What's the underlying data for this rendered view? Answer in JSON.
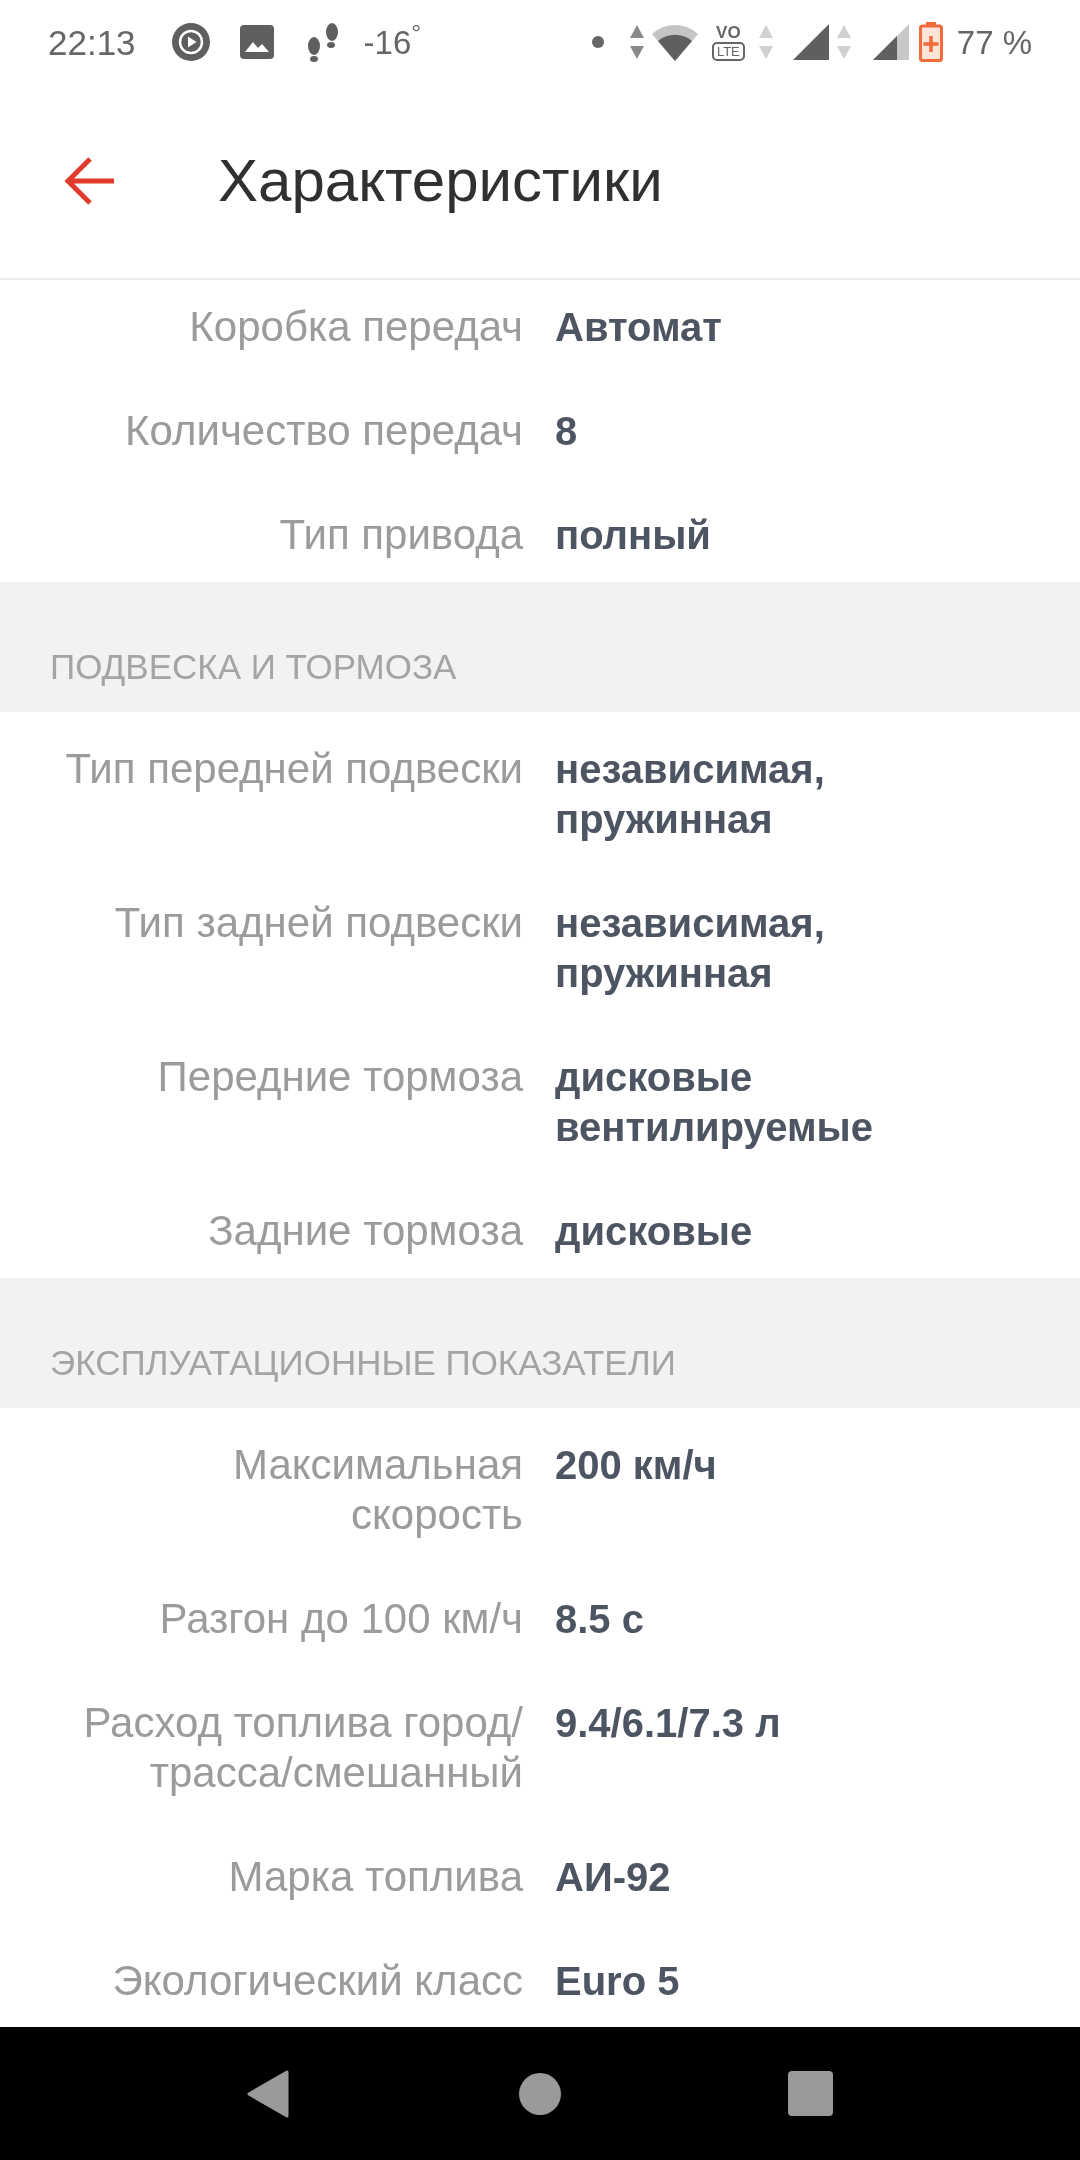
{
  "status_bar": {
    "time": "22:13",
    "temperature": "-16$^{°}$",
    "volte_top": "VO",
    "volte_bottom": "LTE",
    "battery": "77 %"
  },
  "app_bar": {
    "title": "Характеристики"
  },
  "sections": [
    {
      "rows": [
        {
          "label": "Коробка передач",
          "value": "Автомат"
        },
        {
          "label": "Количество передач",
          "value": "8"
        },
        {
          "label": "Тип привода",
          "value": "полный"
        }
      ]
    },
    {
      "heading": "ПОДВЕСКА И ТОРМОЗА",
      "rows": [
        {
          "label": "Тип передней подвески",
          "value": "независимая, пружинная"
        },
        {
          "label": "Тип задней подвески",
          "value": "независимая, пружинная"
        },
        {
          "label": "Передние тормоза",
          "value": "дисковые вентилируемые"
        },
        {
          "label": "Задние тормоза",
          "value": "дисковые"
        }
      ]
    },
    {
      "heading": "ЭКСПЛУАТАЦИОННЫЕ ПОКАЗАТЕЛИ",
      "rows": [
        {
          "label": "Максимальная скорость",
          "value": "200 км/ч"
        },
        {
          "label": "Разгон до 100 км/ч",
          "value": "8.5 с"
        },
        {
          "label": "Расход топлива город/трасса/смешанный",
          "value": "9.4/6.1/7.3 л"
        },
        {
          "label": "Марка топлива",
          "value": "АИ-92"
        },
        {
          "label": "Экологический класс",
          "value": "Euro 5"
        }
      ]
    }
  ]
}
